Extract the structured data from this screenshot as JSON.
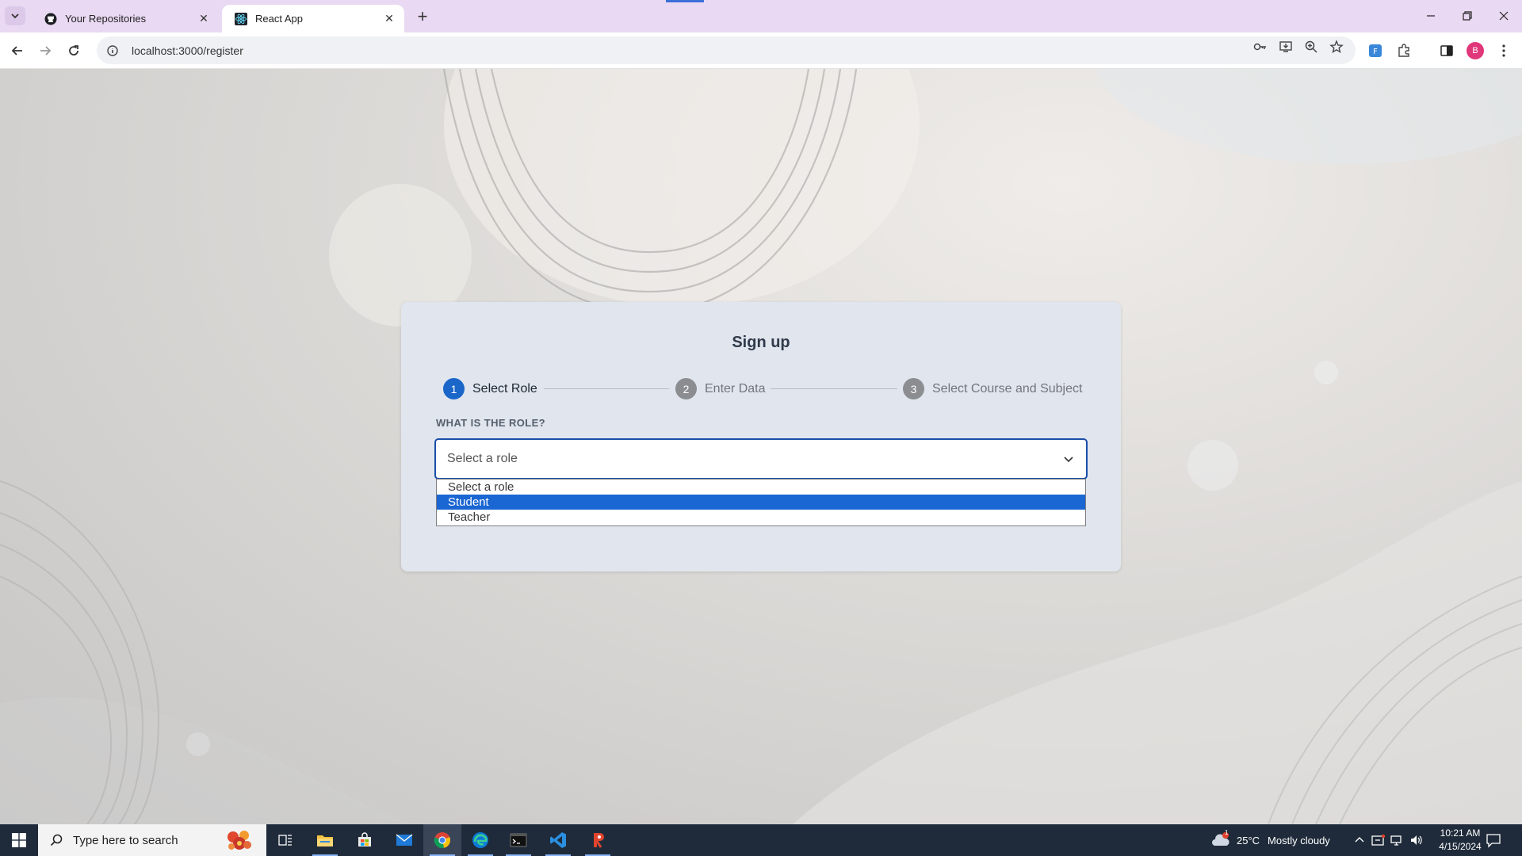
{
  "browser": {
    "tabs": [
      {
        "title": "Your Repositories",
        "icon": "github-icon",
        "active": false
      },
      {
        "title": "React App",
        "icon": "react-icon",
        "active": true
      }
    ],
    "address": "localhost:3000/register"
  },
  "signup": {
    "title": "Sign up",
    "steps": [
      {
        "number": "1",
        "label": "Select Role",
        "active": true
      },
      {
        "number": "2",
        "label": "Enter Data",
        "active": false
      },
      {
        "number": "3",
        "label": "Select Course and Subject",
        "active": false
      }
    ],
    "role_field": {
      "label": "WHAT IS THE ROLE?",
      "value": "Select a role",
      "options": [
        "Select a role",
        "Student",
        "Teacher"
      ],
      "highlighted": "Student"
    }
  },
  "taskbar": {
    "search_placeholder": "Type here to search",
    "weather": {
      "temp": "25°C",
      "condition": "Mostly cloudy",
      "badge": "1"
    },
    "time": "10:21 AM",
    "date": "4/15/2024"
  },
  "colors": {
    "accent": "#1a66c9",
    "tabstrip": "#ead9f3",
    "card": "#e0e5ee",
    "option_highlight": "#1a66d2"
  }
}
